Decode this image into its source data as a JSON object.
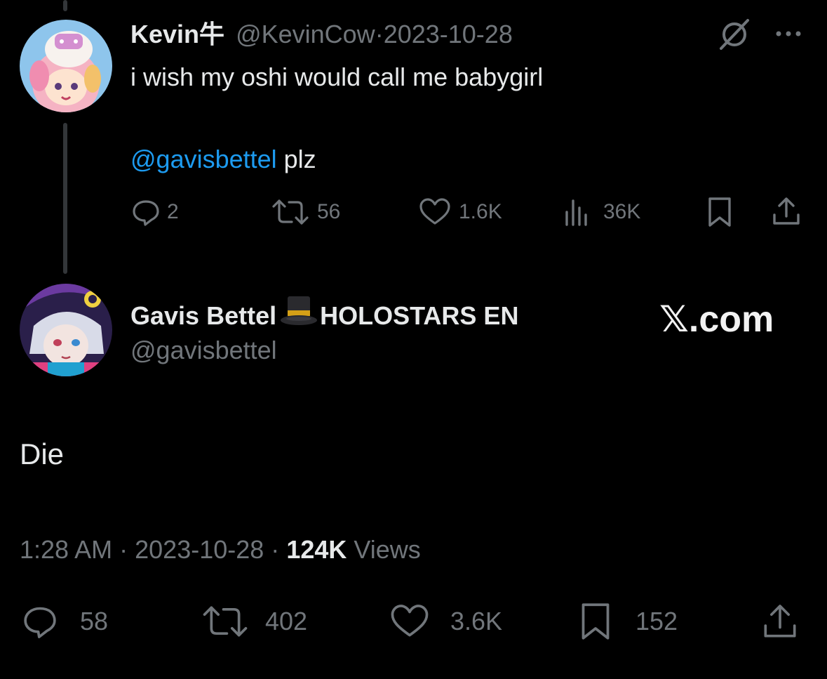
{
  "original_tweet": {
    "display_name": "Kevin牛",
    "handle": "@KevinCow",
    "separator": "·",
    "date": "2023-10-28",
    "text_line1": "i wish my oshi would call me babygirl",
    "mention": "@gavisbettel",
    "text_after_mention": " plz",
    "counts": {
      "replies": "2",
      "reposts": "56",
      "likes": "1.6K",
      "views": "36K"
    }
  },
  "reply_tweet": {
    "display_name": "Gavis Bettel",
    "name_suffix": "HOLOSTARS EN",
    "handle": "@gavisbettel",
    "text": "Die",
    "time": "1:28 AM",
    "sep1": "·",
    "date": "2023-10-28",
    "sep2": "·",
    "views_count": "124K",
    "views_label": "Views",
    "counts": {
      "replies": "58",
      "reposts": "402",
      "likes": "3.6K",
      "bookmarks": "152"
    }
  },
  "watermark": "𝕏.com",
  "icons": {
    "grok": "slashed-circle-icon",
    "more": "more-dots-icon",
    "reply": "reply-bubble-icon",
    "repost": "repost-icon",
    "like": "heart-icon",
    "views": "views-bars-icon",
    "bookmark": "bookmark-icon",
    "share": "share-icon",
    "hat": "top-hat-emoji"
  },
  "colors": {
    "background": "#000000",
    "text": "#e7e9ea",
    "muted": "#71767b",
    "link": "#1d9bf0"
  }
}
